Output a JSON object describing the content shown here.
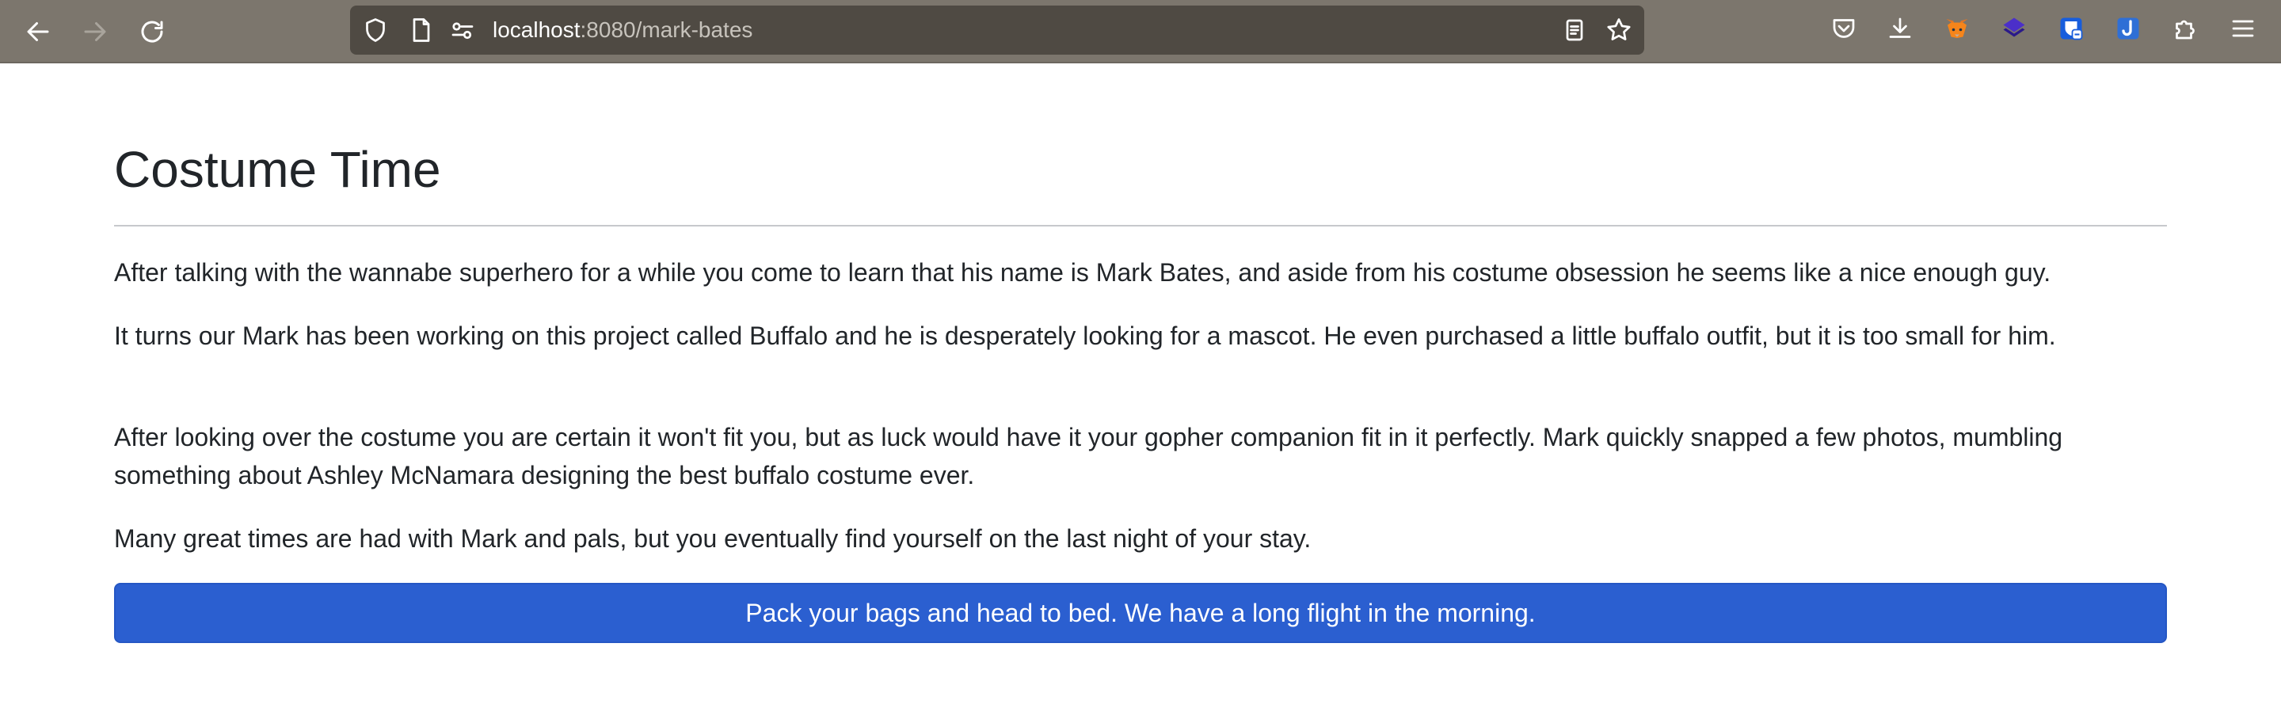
{
  "browser": {
    "url_host": "localhost",
    "url_rest": ":8080/mark-bates",
    "nav_icons": [
      "back-arrow-icon",
      "forward-arrow-icon",
      "reload-icon"
    ],
    "url_icons": [
      "shield-icon",
      "page-icon",
      "site-permissions-icon"
    ],
    "url_actions": [
      "reader-view-icon",
      "bookmark-star-icon"
    ],
    "toolbar_icons": [
      "pocket-icon",
      "downloads-icon",
      "metamask-fox-icon",
      "layers-extension-icon",
      "bitwarden-icon",
      "extension-j-icon",
      "extensions-puzzle-icon",
      "menu-hamburger-icon"
    ],
    "colors": {
      "toolbar": "#7c766d",
      "urlbar": "#4f4a43"
    }
  },
  "page": {
    "title": "Costume Time",
    "paragraphs": [
      "After talking with the wannabe superhero for a while you come to learn that his name is Mark Bates, and aside from his costume obsession he seems like a nice enough guy.",
      "It turns our Mark has been working on this project called Buffalo and he is desperately looking for a mascot. He even purchased a little buffalo outfit, but it is too small for him.",
      "After looking over the costume you are certain it won't fit you, but as luck would have it your gopher companion fit in it perfectly. Mark quickly snapped a few photos, mumbling something about Ashley McNamara designing the best buffalo costume ever.",
      "Many great times are had with Mark and pals, but you eventually find yourself on the last night of your stay."
    ],
    "button_label": "Pack your bags and head to bed. We have a long flight in the morning.",
    "colors": {
      "button": "#2b5fd0",
      "text": "#212529"
    }
  }
}
